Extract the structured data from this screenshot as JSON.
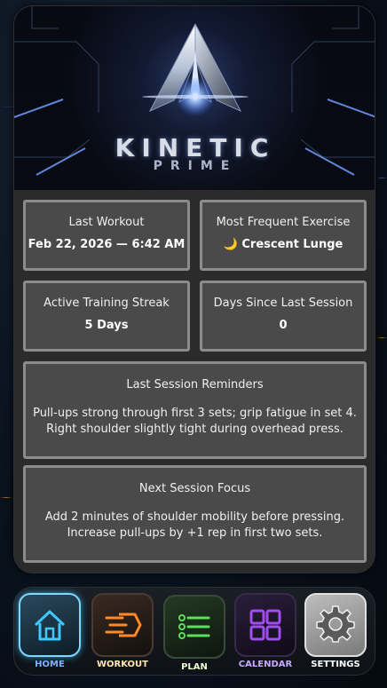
{
  "brand": {
    "line1": "KINETIC",
    "line2": "PRIME"
  },
  "stats": {
    "last_workout": {
      "title": "Last Workout",
      "value": "Feb 22, 2026 — 6:42 AM"
    },
    "most_frequent": {
      "title": "Most Frequent Exercise",
      "icon": "🌙",
      "value": "Crescent Lunge"
    },
    "streak": {
      "title": "Active Training Streak",
      "value": "5 Days"
    },
    "days_since": {
      "title": "Days Since Last Session",
      "value": "0"
    }
  },
  "reminders": {
    "title": "Last Session Reminders",
    "line1": "Pull-ups strong through first 3 sets; grip fatigue in set 4.",
    "line2": "Right shoulder slightly tight during overhead press."
  },
  "focus": {
    "title": "Next Session Focus",
    "line1": "Add 2 minutes of shoulder mobility before pressing.",
    "line2": "Increase pull-ups by +1 rep in first two sets."
  },
  "nav": [
    {
      "label": "HOME",
      "icon": "home-icon",
      "color": "#3ec8ff",
      "active": true
    },
    {
      "label": "WORKOUT",
      "icon": "dash-arrow-icon",
      "color": "#ff8a2a",
      "active": false
    },
    {
      "label": "PLAN",
      "icon": "list-icon",
      "color": "#58e05a",
      "active": false
    },
    {
      "label": "CALENDAR",
      "icon": "grid-icon",
      "color": "#a04ef0",
      "active": false
    },
    {
      "label": "SETTINGS",
      "icon": "gear-icon",
      "color": "#d8d8d8",
      "active": false
    }
  ]
}
